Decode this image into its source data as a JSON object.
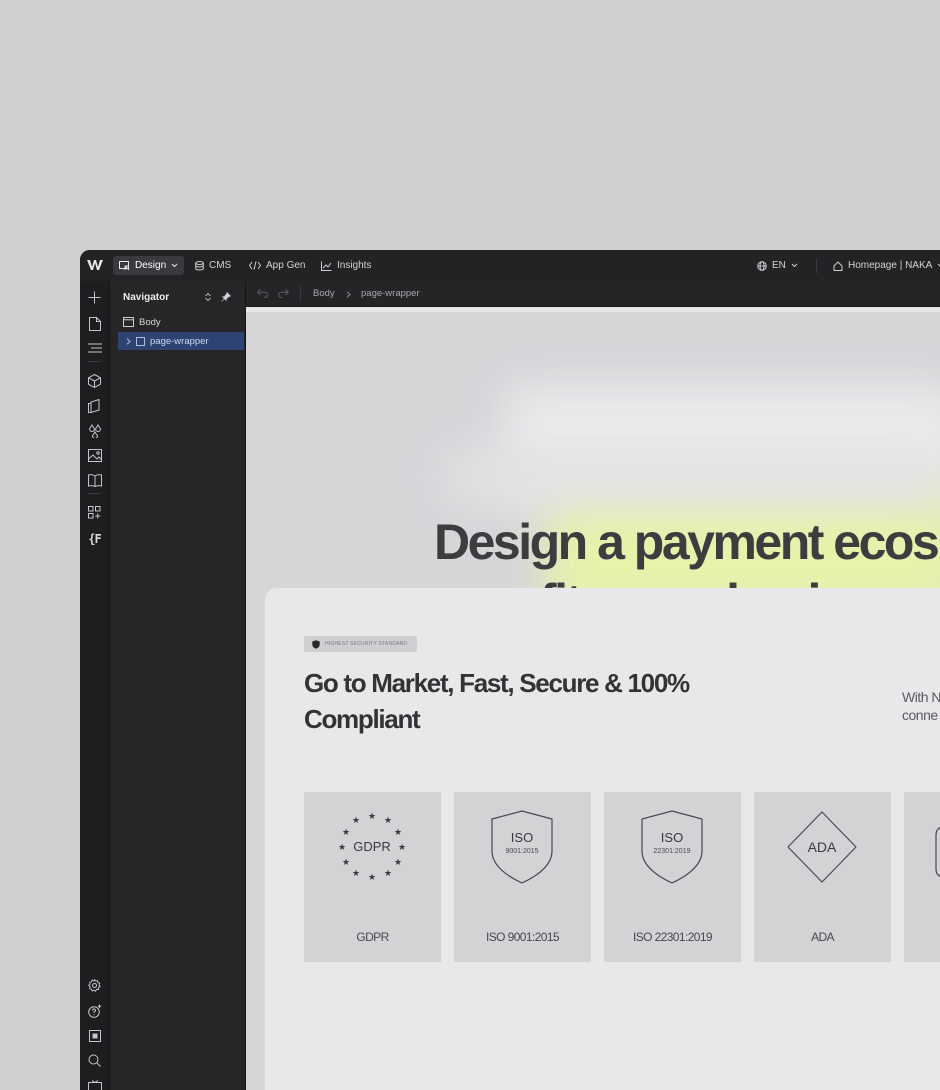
{
  "topbar": {
    "tabs": [
      {
        "label": "Design",
        "icon": "design-icon",
        "active": true
      },
      {
        "label": "CMS",
        "icon": "database-icon"
      },
      {
        "label": "App Gen",
        "icon": "code-icon"
      },
      {
        "label": "Insights",
        "icon": "chart-icon"
      }
    ],
    "language": "EN",
    "page_selector": "Homepage | NAKA"
  },
  "navigator": {
    "title": "Navigator",
    "items": [
      {
        "label": "Body"
      },
      {
        "label": "page-wrapper",
        "selected": true
      }
    ]
  },
  "breadcrumb": {
    "items": [
      "Body",
      "page-wrapper"
    ]
  },
  "site": {
    "hero_line1": "Design a payment ecos",
    "hero_line2": "fits your business n",
    "badge": "HIGHEST SECURITY STANDARD",
    "section_title": "Go to Market, Fast, Secure & 100% Compliant",
    "side_text_line1": "With N",
    "side_text_line2": "conne",
    "certs": [
      {
        "label": "GDPR",
        "art": "GDPR"
      },
      {
        "label": "ISO 9001:2015",
        "art": "ISO",
        "sub": "9001:2015"
      },
      {
        "label": "ISO 22301:2019",
        "art": "ISO",
        "sub": "22301:2019"
      },
      {
        "label": "ADA",
        "art": "ADA"
      }
    ]
  },
  "colors": {
    "accent_selected": "#2f4372",
    "glow": "#e9f6a6"
  }
}
